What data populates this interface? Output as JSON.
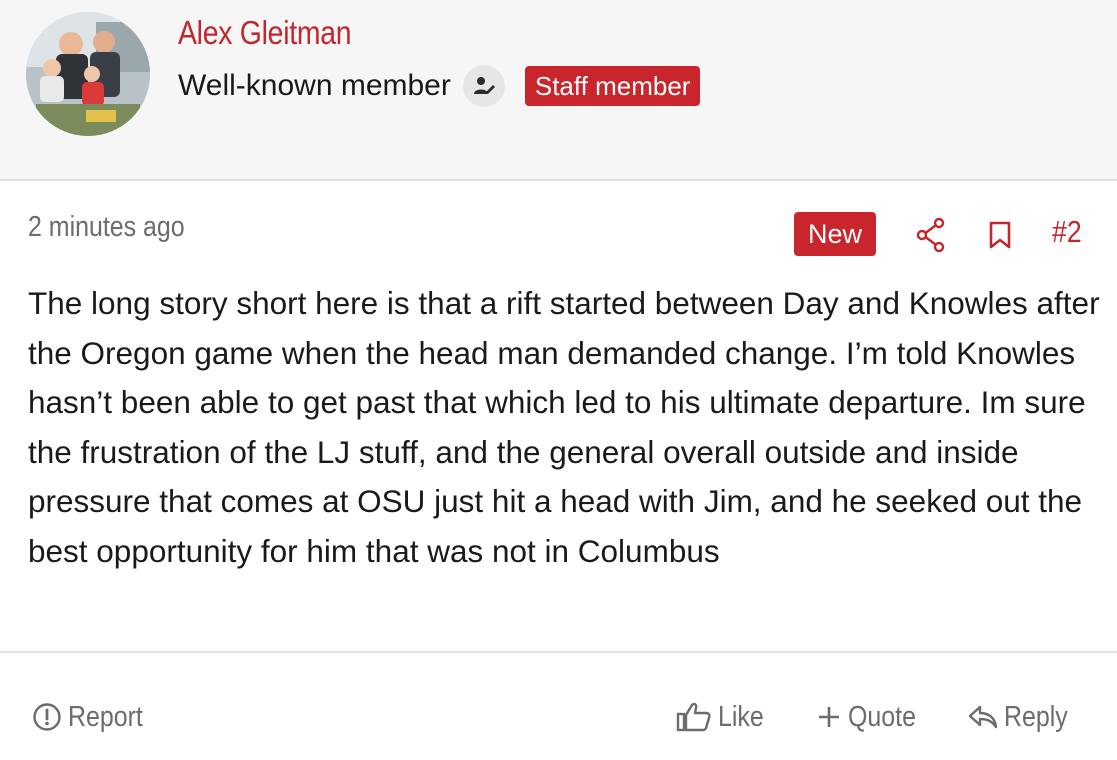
{
  "post": {
    "author": {
      "name": "Alex Gleitman",
      "title": "Well-known member",
      "staff_badge": "Staff member",
      "avatar_icon": "family-photo-avatar",
      "role_icon": "user-edit-icon"
    },
    "meta": {
      "time": "2 minutes ago",
      "new_badge": "New",
      "post_number": "#2"
    },
    "body": "The long story short here is that a rift started between Day and Knowles after the Oregon game when the head man demanded change. I’m told Knowles hasn’t been able to get past that which led to his ultimate departure. Im sure the frustration of the LJ stuff, and the general overall outside and inside pressure that comes at OSU just hit a head with Jim, and he seeked out the best opportunity for him that was not in Columbus",
    "actions": {
      "report": "Report",
      "like": "Like",
      "quote": "Quote",
      "reply": "Reply"
    }
  },
  "colors": {
    "accent": "#c1272d",
    "badge_bg": "#c9252c",
    "header_bg": "#f7f6f7",
    "muted_text": "#6b6b70"
  }
}
